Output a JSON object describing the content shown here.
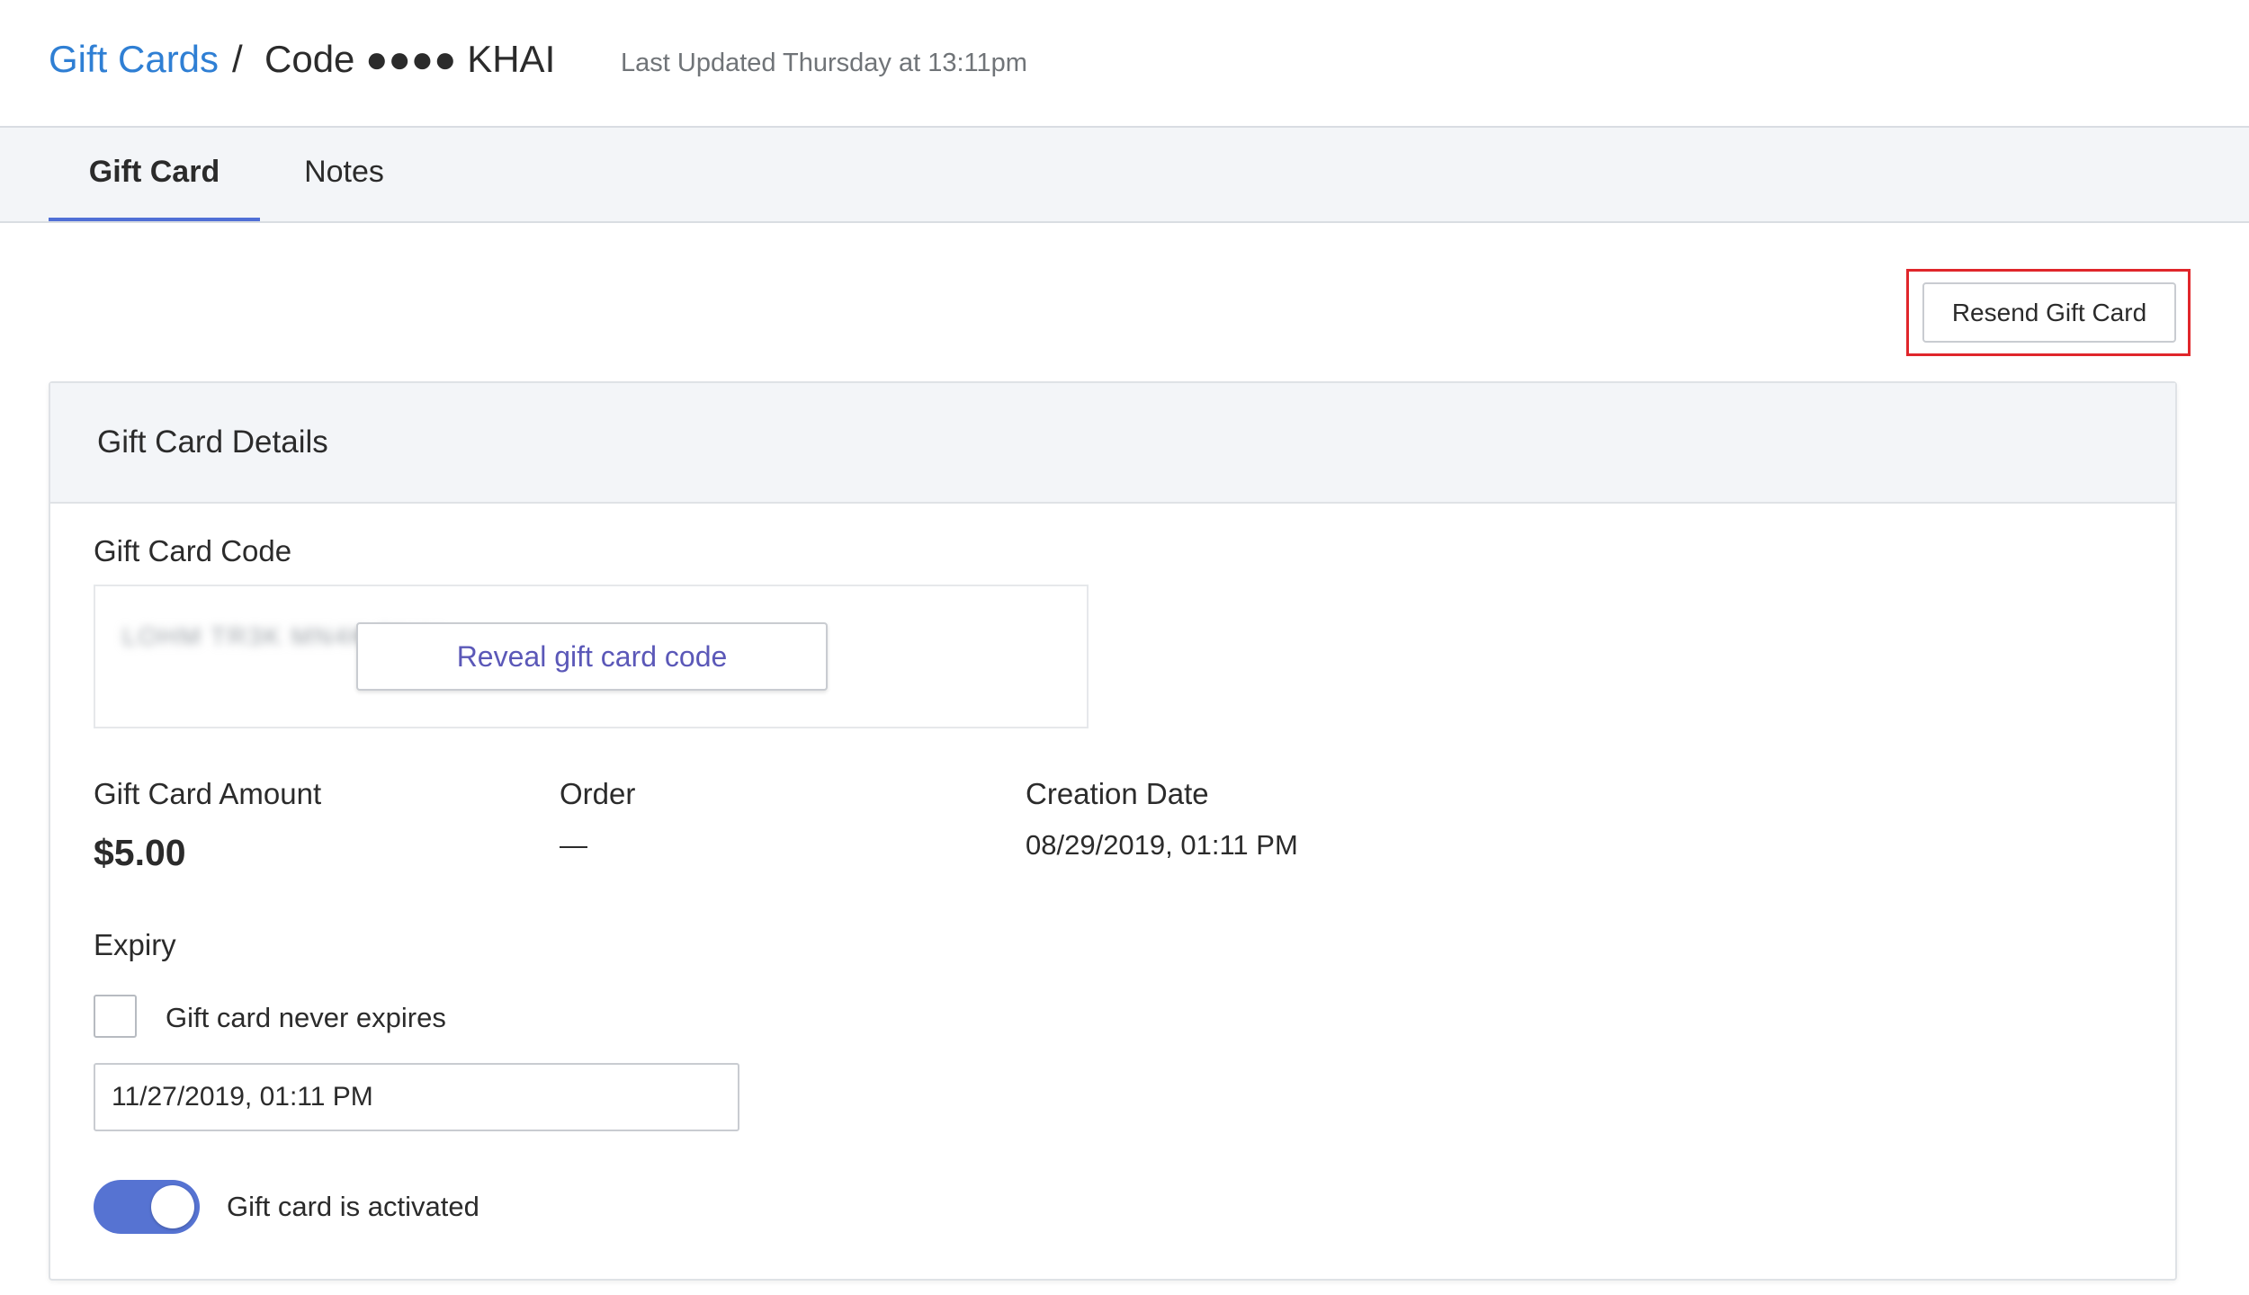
{
  "header": {
    "breadcrumb_link": "Gift Cards",
    "breadcrumb_separator": "/",
    "breadcrumb_current": "Code ●●●● KHAI",
    "last_updated": "Last Updated Thursday at 13:11pm"
  },
  "tabs": [
    {
      "label": "Gift Card",
      "active": true
    },
    {
      "label": "Notes",
      "active": false
    }
  ],
  "actions": {
    "resend_label": "Resend Gift Card"
  },
  "card": {
    "title": "Gift Card Details",
    "code_label": "Gift Card Code",
    "reveal_label": "Reveal gift card code",
    "amount_label": "Gift Card Amount",
    "amount_value": "$5.00",
    "order_label": "Order",
    "order_value": "—",
    "creation_label": "Creation Date",
    "creation_value": "08/29/2019, 01:11 PM",
    "expiry_label": "Expiry",
    "never_expires_label": "Gift card never expires",
    "never_expires_checked": false,
    "expiry_value": "11/27/2019, 01:11 PM",
    "activated_label": "Gift card is activated",
    "activated": true
  },
  "colors": {
    "link": "#2f7fd4",
    "tab_underline": "#4f6fd6",
    "toggle_on": "#5673d2",
    "highlight_box": "#e0262b",
    "reveal_text": "#5b58b8"
  }
}
